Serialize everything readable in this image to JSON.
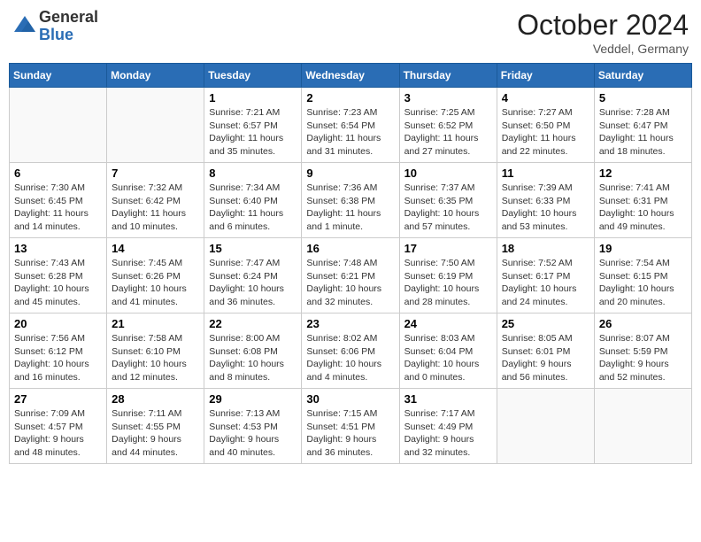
{
  "header": {
    "logo_general": "General",
    "logo_blue": "Blue",
    "month": "October 2024",
    "location": "Veddel, Germany"
  },
  "weekdays": [
    "Sunday",
    "Monday",
    "Tuesday",
    "Wednesday",
    "Thursday",
    "Friday",
    "Saturday"
  ],
  "weeks": [
    [
      {
        "day": "",
        "info": ""
      },
      {
        "day": "",
        "info": ""
      },
      {
        "day": "1",
        "info": "Sunrise: 7:21 AM\nSunset: 6:57 PM\nDaylight: 11 hours and 35 minutes."
      },
      {
        "day": "2",
        "info": "Sunrise: 7:23 AM\nSunset: 6:54 PM\nDaylight: 11 hours and 31 minutes."
      },
      {
        "day": "3",
        "info": "Sunrise: 7:25 AM\nSunset: 6:52 PM\nDaylight: 11 hours and 27 minutes."
      },
      {
        "day": "4",
        "info": "Sunrise: 7:27 AM\nSunset: 6:50 PM\nDaylight: 11 hours and 22 minutes."
      },
      {
        "day": "5",
        "info": "Sunrise: 7:28 AM\nSunset: 6:47 PM\nDaylight: 11 hours and 18 minutes."
      }
    ],
    [
      {
        "day": "6",
        "info": "Sunrise: 7:30 AM\nSunset: 6:45 PM\nDaylight: 11 hours and 14 minutes."
      },
      {
        "day": "7",
        "info": "Sunrise: 7:32 AM\nSunset: 6:42 PM\nDaylight: 11 hours and 10 minutes."
      },
      {
        "day": "8",
        "info": "Sunrise: 7:34 AM\nSunset: 6:40 PM\nDaylight: 11 hours and 6 minutes."
      },
      {
        "day": "9",
        "info": "Sunrise: 7:36 AM\nSunset: 6:38 PM\nDaylight: 11 hours and 1 minute."
      },
      {
        "day": "10",
        "info": "Sunrise: 7:37 AM\nSunset: 6:35 PM\nDaylight: 10 hours and 57 minutes."
      },
      {
        "day": "11",
        "info": "Sunrise: 7:39 AM\nSunset: 6:33 PM\nDaylight: 10 hours and 53 minutes."
      },
      {
        "day": "12",
        "info": "Sunrise: 7:41 AM\nSunset: 6:31 PM\nDaylight: 10 hours and 49 minutes."
      }
    ],
    [
      {
        "day": "13",
        "info": "Sunrise: 7:43 AM\nSunset: 6:28 PM\nDaylight: 10 hours and 45 minutes."
      },
      {
        "day": "14",
        "info": "Sunrise: 7:45 AM\nSunset: 6:26 PM\nDaylight: 10 hours and 41 minutes."
      },
      {
        "day": "15",
        "info": "Sunrise: 7:47 AM\nSunset: 6:24 PM\nDaylight: 10 hours and 36 minutes."
      },
      {
        "day": "16",
        "info": "Sunrise: 7:48 AM\nSunset: 6:21 PM\nDaylight: 10 hours and 32 minutes."
      },
      {
        "day": "17",
        "info": "Sunrise: 7:50 AM\nSunset: 6:19 PM\nDaylight: 10 hours and 28 minutes."
      },
      {
        "day": "18",
        "info": "Sunrise: 7:52 AM\nSunset: 6:17 PM\nDaylight: 10 hours and 24 minutes."
      },
      {
        "day": "19",
        "info": "Sunrise: 7:54 AM\nSunset: 6:15 PM\nDaylight: 10 hours and 20 minutes."
      }
    ],
    [
      {
        "day": "20",
        "info": "Sunrise: 7:56 AM\nSunset: 6:12 PM\nDaylight: 10 hours and 16 minutes."
      },
      {
        "day": "21",
        "info": "Sunrise: 7:58 AM\nSunset: 6:10 PM\nDaylight: 10 hours and 12 minutes."
      },
      {
        "day": "22",
        "info": "Sunrise: 8:00 AM\nSunset: 6:08 PM\nDaylight: 10 hours and 8 minutes."
      },
      {
        "day": "23",
        "info": "Sunrise: 8:02 AM\nSunset: 6:06 PM\nDaylight: 10 hours and 4 minutes."
      },
      {
        "day": "24",
        "info": "Sunrise: 8:03 AM\nSunset: 6:04 PM\nDaylight: 10 hours and 0 minutes."
      },
      {
        "day": "25",
        "info": "Sunrise: 8:05 AM\nSunset: 6:01 PM\nDaylight: 9 hours and 56 minutes."
      },
      {
        "day": "26",
        "info": "Sunrise: 8:07 AM\nSunset: 5:59 PM\nDaylight: 9 hours and 52 minutes."
      }
    ],
    [
      {
        "day": "27",
        "info": "Sunrise: 7:09 AM\nSunset: 4:57 PM\nDaylight: 9 hours and 48 minutes."
      },
      {
        "day": "28",
        "info": "Sunrise: 7:11 AM\nSunset: 4:55 PM\nDaylight: 9 hours and 44 minutes."
      },
      {
        "day": "29",
        "info": "Sunrise: 7:13 AM\nSunset: 4:53 PM\nDaylight: 9 hours and 40 minutes."
      },
      {
        "day": "30",
        "info": "Sunrise: 7:15 AM\nSunset: 4:51 PM\nDaylight: 9 hours and 36 minutes."
      },
      {
        "day": "31",
        "info": "Sunrise: 7:17 AM\nSunset: 4:49 PM\nDaylight: 9 hours and 32 minutes."
      },
      {
        "day": "",
        "info": ""
      },
      {
        "day": "",
        "info": ""
      }
    ]
  ]
}
